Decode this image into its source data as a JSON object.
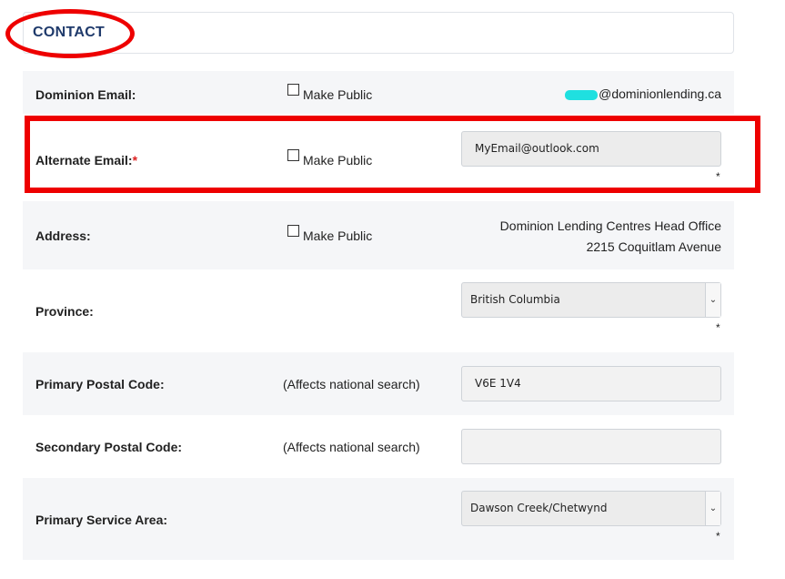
{
  "header": {
    "title": "CONTACT"
  },
  "rows": {
    "dominion_email": {
      "label": "Dominion Email:",
      "make_public": "Make Public",
      "value_suffix": "@dominionlending.ca"
    },
    "alternate_email": {
      "label": "Alternate Email:",
      "required_mark": "*",
      "make_public": "Make Public",
      "value": "MyEmail@outlook.com",
      "star": "*"
    },
    "address": {
      "label": "Address:",
      "make_public": "Make Public",
      "line1": "Dominion Lending Centres Head Office",
      "line2": "2215 Coquitlam Avenue"
    },
    "province": {
      "label": "Province:",
      "selected": "British Columbia",
      "star": "*"
    },
    "primary_postal": {
      "label": "Primary Postal Code:",
      "note": "(Affects national search)",
      "value": "V6E 1V4"
    },
    "secondary_postal": {
      "label": "Secondary Postal Code:",
      "note": "(Affects national search)",
      "value": ""
    },
    "primary_service_area": {
      "label": "Primary Service Area:",
      "selected": "Dawson Creek/Chetwynd",
      "star": "*"
    }
  },
  "icons": {
    "chevron": "chevron-down-icon",
    "checkbox": "checkbox-icon"
  },
  "colors": {
    "annotation": "#ee0000",
    "heading": "#1f3a6b",
    "row_alt": "#f5f6f8"
  }
}
